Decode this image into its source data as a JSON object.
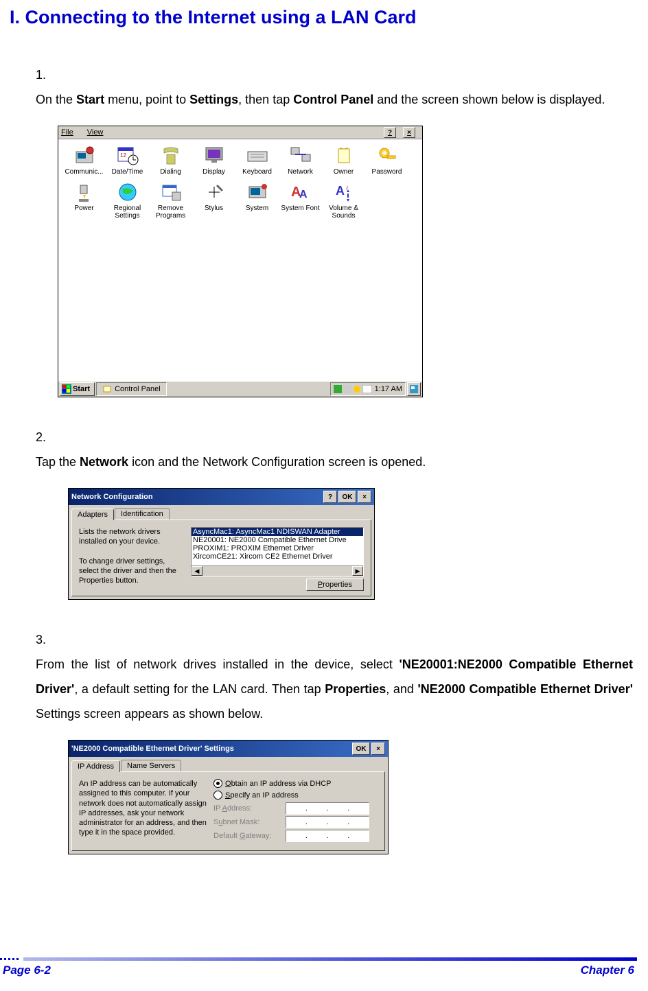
{
  "title": "I.    Connecting to the Internet using a LAN Card",
  "steps": {
    "s1": {
      "num": "1.",
      "before": "On the ",
      "b1": "Start",
      "mid1": " menu, point to ",
      "b2": "Settings",
      "mid2": ", then tap ",
      "b3": "Control Panel",
      "after": " and the screen shown below is displayed."
    },
    "s2": {
      "num": "2.",
      "before": "Tap the ",
      "b1": "Network",
      "after": " icon and the Network Configuration screen is opened."
    },
    "s3": {
      "num": "3.",
      "t1": "From the list of network drives installed in the device, select ",
      "b1": "'NE20001:NE2000 Compatible Ethernet Driver'",
      "t2": ", a default setting for the LAN card. Then tap ",
      "b2": "Properties",
      "t3": ", and ",
      "b3": "'NE2000 Compatible Ethernet Driver'",
      "t4": " Settings screen appears as shown below."
    }
  },
  "controlPanel": {
    "menu": {
      "file": "File",
      "view": "View"
    },
    "helpBtn": "?",
    "closeBtn": "×",
    "icons": [
      {
        "label": "Communic..."
      },
      {
        "label": "Date/Time"
      },
      {
        "label": "Dialing"
      },
      {
        "label": "Display"
      },
      {
        "label": "Keyboard"
      },
      {
        "label": "Network"
      },
      {
        "label": "Owner"
      },
      {
        "label": "Password"
      },
      {
        "label": "Power"
      },
      {
        "label": "Regional Settings"
      },
      {
        "label": "Remove Programs"
      },
      {
        "label": "Stylus"
      },
      {
        "label": "System"
      },
      {
        "label": "System Font"
      },
      {
        "label": "Volume & Sounds"
      }
    ],
    "taskbar": {
      "start": "Start",
      "active": "Control Panel",
      "time": "1:17 AM"
    }
  },
  "netConfig": {
    "title": "Network Configuration",
    "help": "?",
    "ok": "OK",
    "close": "×",
    "tabs": {
      "adapters": "Adapters",
      "identification": "Identification"
    },
    "desc1": "Lists the network drivers installed on your device.",
    "desc2": "To change driver settings, select the driver and then the Properties button.",
    "list": [
      "AsyncMac1: AsyncMac1 NDISWAN Adapter",
      "NE20001: NE2000 Compatible Ethernet Drive",
      "PROXIM1: PROXIM Ethernet Driver",
      "XircomCE21: Xircom CE2 Ethernet Driver"
    ],
    "properties": "Properties"
  },
  "driverSettings": {
    "title": "'NE2000 Compatible Ethernet Driver' Settings",
    "ok": "OK",
    "close": "×",
    "tabs": {
      "ip": "IP Address",
      "ns": "Name Servers"
    },
    "desc": "An IP address can be automatically assigned to this computer.  If your network does not automatically assign IP addresses, ask your network administrator for an address, and then type it in the space provided.",
    "radio1": "Obtain an IP address via DHCP",
    "radio2": "Specify an IP address",
    "ipAddr": "IP Address:",
    "subnet": "Subnet Mask:",
    "gateway": "Default Gateway:",
    "dot": "."
  },
  "footer": {
    "left": "Page 6-2",
    "right": "Chapter 6"
  }
}
